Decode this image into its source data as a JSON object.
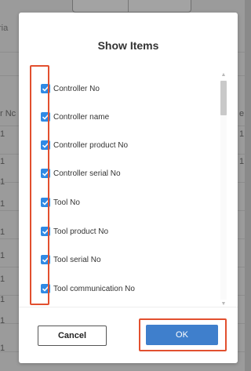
{
  "background": {
    "top_left_label": "ria",
    "left_labels": [
      "r Nc",
      "1",
      "1",
      "1",
      "1",
      "1",
      "1",
      "1",
      "1",
      "1",
      "1"
    ],
    "right_labels": [
      "e",
      "1",
      "1"
    ]
  },
  "dialog": {
    "title": "Show Items",
    "items": [
      {
        "label": "Controller No",
        "checked": true
      },
      {
        "label": "Controller name",
        "checked": true
      },
      {
        "label": "Controller product No",
        "checked": true
      },
      {
        "label": "Controller serial No",
        "checked": true
      },
      {
        "label": "Tool No",
        "checked": true
      },
      {
        "label": "Tool product No",
        "checked": true
      },
      {
        "label": "Tool serial No",
        "checked": true
      },
      {
        "label": "Tool communication No",
        "checked": true
      }
    ],
    "scroll_up_icon": "▲",
    "scroll_down_icon": "▼",
    "cancel_label": "Cancel",
    "ok_label": "OK"
  },
  "colors": {
    "checkbox": "#2f8ae5",
    "ok_button": "#3f7fcc",
    "highlight": "#e2502f",
    "overlay": "#9b9b9b"
  }
}
